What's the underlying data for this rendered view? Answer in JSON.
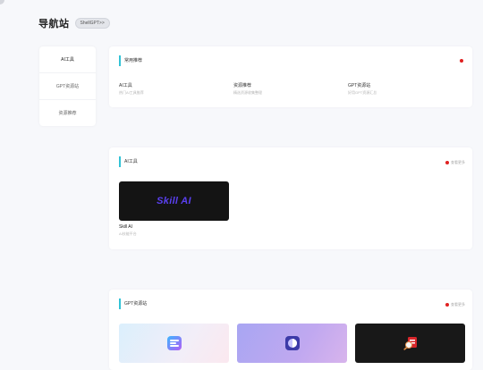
{
  "header": {
    "title": "导航站",
    "pill": "ShellGPT>>"
  },
  "sidebar": {
    "items": [
      {
        "label": "AI工具"
      },
      {
        "label": "GPT资源站"
      },
      {
        "label": "资源推荐"
      }
    ]
  },
  "section1": {
    "title": "常用推荐",
    "links": [
      {
        "title": "AI工具",
        "desc": "热门AI工具推荐"
      },
      {
        "title": "资源推荐",
        "desc": "精选资源收集整理"
      },
      {
        "title": "GPT资源站",
        "desc": "好用GPT资源汇总"
      }
    ]
  },
  "section2": {
    "title": "AI工具",
    "more": "查看更多",
    "tools": [
      {
        "name": "Skill AI",
        "logo": "Skill AI",
        "desc": "AI技能平台"
      }
    ]
  },
  "section3": {
    "title": "GPT资源站",
    "more": "查看更多"
  },
  "colors": {
    "accent": "#33c3d6",
    "notify": "#e02020",
    "logo": "#5a40f0"
  }
}
